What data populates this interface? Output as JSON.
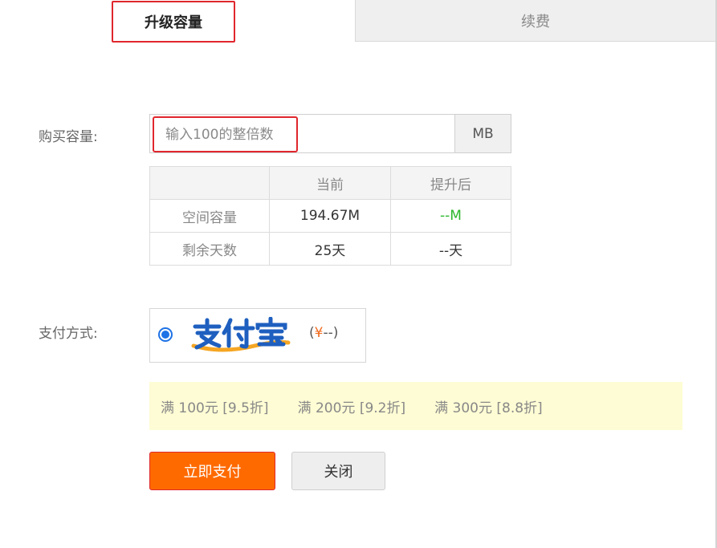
{
  "tabs": {
    "upgrade": "升级容量",
    "renew": "续费"
  },
  "form": {
    "capacity_label": "购买容量:",
    "capacity_placeholder": "输入100的整倍数",
    "unit": "MB",
    "payment_label": "支付方式:"
  },
  "table": {
    "headers": [
      "",
      "当前",
      "提升后"
    ],
    "rows": [
      {
        "label": "空间容量",
        "current": "194.67M",
        "after": "--M"
      },
      {
        "label": "剩余天数",
        "current": "25天",
        "after": "--天"
      }
    ]
  },
  "payment": {
    "method": "支付宝",
    "price_currency": "¥",
    "price_text": "(¥--)",
    "price_prefix": "(",
    "price_value": "--)",
    "selected": true,
    "colors": {
      "alipay_blue": "#1e72e6",
      "alipay_orange": "#f5a623"
    }
  },
  "discounts": [
    "满 100元 [9.5折]",
    "满 200元 [9.2折]",
    "满 300元 [8.8折]"
  ],
  "buttons": {
    "pay": "立即支付",
    "close": "关闭"
  },
  "colors": {
    "accent_red": "#e0272d",
    "pay_orange": "#ff6a00",
    "green": "#2cb62c",
    "discount_bg": "#fefcd4"
  }
}
